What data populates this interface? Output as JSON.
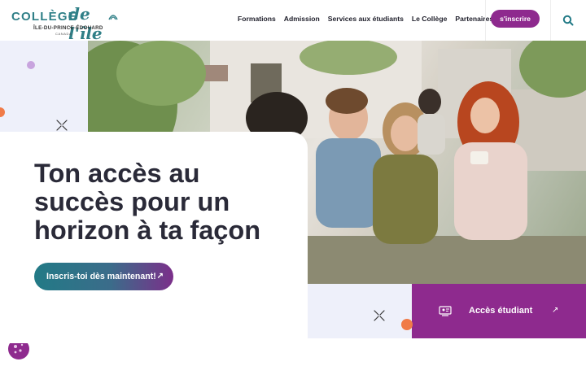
{
  "logo": {
    "word1": "COLLÈGE",
    "word2": "de l'île",
    "subtitle": "ÎLE-DU-PRINCE-ÉDOUARD",
    "country": "CANADA"
  },
  "nav": {
    "items": [
      "Formations",
      "Admission",
      "Services aux étudiants",
      "Le Collège",
      "Partenaires"
    ],
    "signup": "s'inscrire"
  },
  "hero": {
    "title": "Ton accès au succès pour un horizon à ta façon",
    "cta_label": "Inscris-toi dès maintenant!",
    "cta_arrow": "↗"
  },
  "student_access": {
    "label": "Accès étudiant",
    "arrow": "↗"
  },
  "colors": {
    "accent_purple": "#8e2a8e",
    "teal": "#227a86",
    "orange": "#f07b48",
    "panel": "#eef0fa"
  },
  "icons": [
    "search-icon",
    "student-portal-icon",
    "cookie-icon",
    "close-x-icon",
    "arrow-up-right-icon"
  ]
}
